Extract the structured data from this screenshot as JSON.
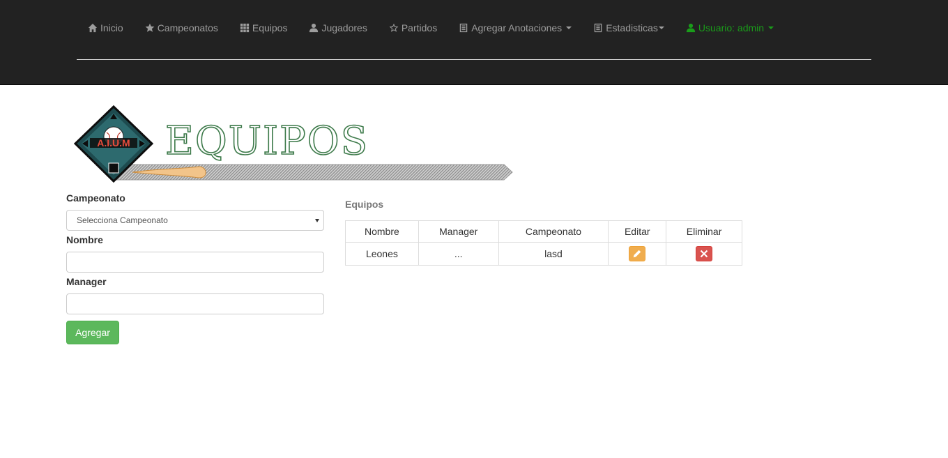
{
  "nav": {
    "items": [
      {
        "label": "Inicio",
        "icon": "home-icon"
      },
      {
        "label": "Campeonatos",
        "icon": "star-icon"
      },
      {
        "label": "Equipos",
        "icon": "grid-icon"
      },
      {
        "label": "Jugadores",
        "icon": "user-icon"
      },
      {
        "label": "Partidos",
        "icon": "star-outline-icon"
      },
      {
        "label": "Agregar Anotaciones",
        "icon": "list-icon"
      },
      {
        "label": "Estadisticas",
        "icon": "list-icon"
      }
    ],
    "user_label": "Usuario: admin"
  },
  "banner": {
    "title": "EQUIPOS",
    "logo_text": "A.I.U.M"
  },
  "form": {
    "campeonato_label": "Campeonato",
    "campeonato_selected": "Selecciona Campeonato",
    "nombre_label": "Nombre",
    "nombre_value": "",
    "manager_label": "Manager",
    "manager_value": "",
    "submit_label": "Agregar"
  },
  "table": {
    "title": "Equipos",
    "columns": [
      "Nombre",
      "Manager",
      "Campeonato",
      "Editar",
      "Eliminar"
    ],
    "rows": [
      {
        "nombre": "Leones",
        "manager": "...",
        "campeonato": "lasd"
      }
    ]
  },
  "colors": {
    "navbar_bg": "#222222",
    "success": "#5cb85c",
    "warning": "#f0ad4e",
    "danger": "#d9534f",
    "user_green": "#1a9c1a"
  }
}
